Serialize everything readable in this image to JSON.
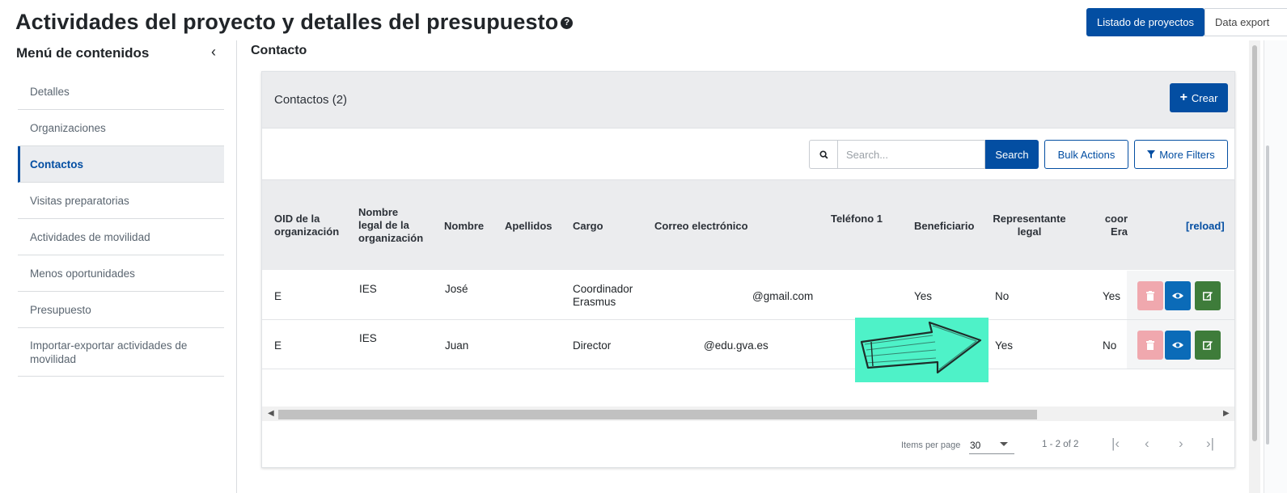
{
  "page": {
    "title": "Actividades del proyecto y detalles del presupuesto",
    "help_icon": "question-circle-icon"
  },
  "top_actions": {
    "primary_label": "Listado de proyectos",
    "secondary_label": "Data export"
  },
  "sidebar": {
    "header": "Menú de contenidos",
    "collapse_icon": "chevron-left-icon",
    "items": [
      {
        "label": "Detalles",
        "active": false
      },
      {
        "label": "Organizaciones",
        "active": false
      },
      {
        "label": "Contactos",
        "active": true
      },
      {
        "label": "Visitas preparatorias",
        "active": false
      },
      {
        "label": "Actividades de movilidad",
        "active": false
      },
      {
        "label": "Menos oportunidades",
        "active": false
      },
      {
        "label": "Presupuesto",
        "active": false
      },
      {
        "label": "Importar-exportar actividades de movilidad",
        "active": false
      }
    ]
  },
  "main": {
    "section_title": "Contacto",
    "card": {
      "title": "Contactos (2)",
      "create_label": "Crear",
      "search": {
        "placeholder": "Search...",
        "button_label": "Search"
      },
      "bulk_label": "Bulk Actions",
      "filters_label": "More Filters",
      "columns": [
        "OID de la organización",
        "Nombre legal de la organización",
        "Nombre",
        "Apellidos",
        "Cargo",
        "Correo electrónico",
        "Teléfono 1",
        "Beneficiario",
        "Representante legal",
        "coor\nEra"
      ],
      "reload_label": "[reload]",
      "rows": [
        {
          "oid": "E",
          "org": "IES",
          "nombre": "José",
          "apellidos": "",
          "cargo": "Coordinador Erasmus",
          "email": "@gmail.com",
          "telefono": "",
          "beneficiario": "Yes",
          "representante": "No",
          "coord": "Yes"
        },
        {
          "oid": "E",
          "org": "IES",
          "nombre": "Juan",
          "apellidos": "",
          "cargo": "Director",
          "email": "@edu.gva.es",
          "telefono": "",
          "beneficiario": "",
          "representante": "Yes",
          "coord": "No"
        }
      ],
      "paginator": {
        "items_per_page_label": "Items per page",
        "page_size": "30",
        "range_label": "1 - 2 of 2"
      }
    }
  },
  "colors": {
    "primary": "#034ea2",
    "delete": "#f0a8ae",
    "view": "#0b6bb8",
    "edit": "#3e7c3a",
    "overlay": "#4ef2c8"
  }
}
